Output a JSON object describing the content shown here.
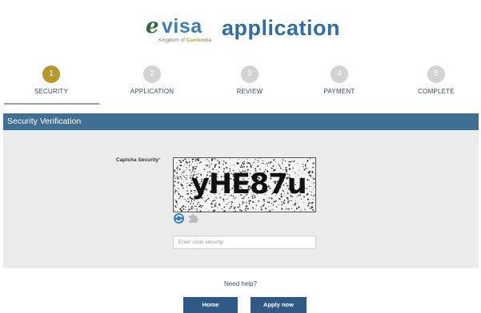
{
  "header": {
    "logo_mark": "e",
    "logo_visa": "visa",
    "logo_sub_prefix": "Kingdom of ",
    "logo_sub_brand": "Cambodia",
    "title": "application"
  },
  "steps": [
    {
      "number": "1",
      "label": "SECURITY",
      "active": true
    },
    {
      "number": "2",
      "label": "APPLICATION",
      "active": false
    },
    {
      "number": "3",
      "label": "REVIEW",
      "active": false
    },
    {
      "number": "4",
      "label": "PAYMENT",
      "active": false
    },
    {
      "number": "5",
      "label": "COMPLETE",
      "active": false
    }
  ],
  "section": {
    "title": "Security Verification"
  },
  "form": {
    "captcha_label": "Captcha Security",
    "required_mark": "*",
    "captcha_text": "yHE87u",
    "code_placeholder": "Enter code security",
    "code_value": "",
    "refresh_icon": "refresh-icon",
    "puzzle_icon": "puzzle-icon"
  },
  "footer": {
    "help_text": "Need help?",
    "home_label": "Home",
    "apply_label": "Apply now"
  },
  "colors": {
    "active_step": "#b59a2b",
    "inactive_step": "#d3d3d3",
    "section_bar": "#3f6f93",
    "button": "#2f5a86",
    "title_blue": "#2d6ea6",
    "logo_green": "#2e6e3a"
  }
}
